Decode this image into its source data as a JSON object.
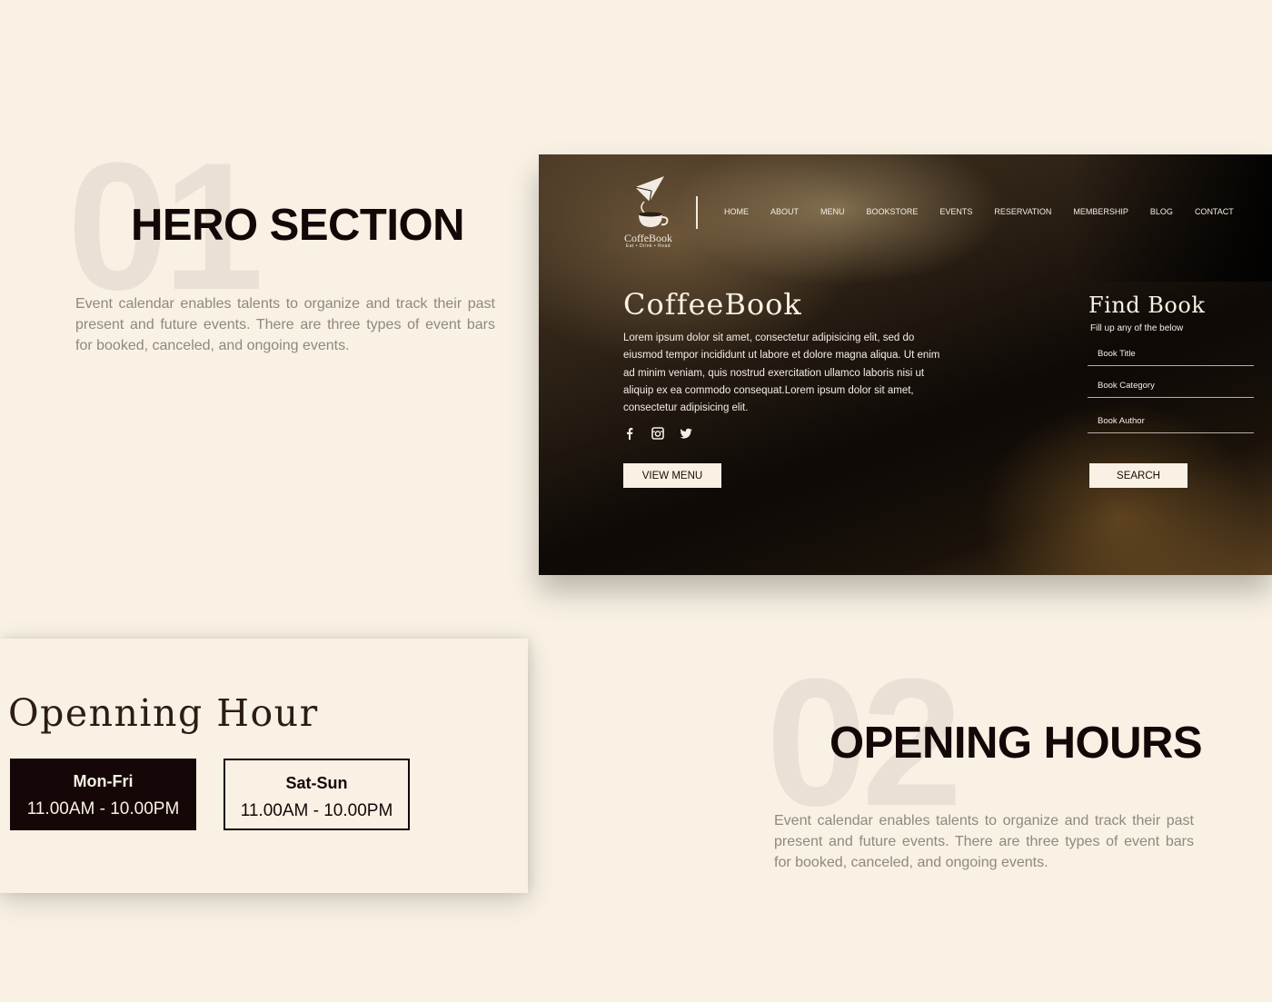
{
  "section1": {
    "number": "01",
    "title": "HERO SECTION",
    "description": "Event calendar enables talents to organize and track their past present and future events. There are three types of event bars for booked, canceled, and ongoing events."
  },
  "hero": {
    "logo": {
      "brand": "CoffeBook",
      "tagline": "Eat • Drink • Read"
    },
    "nav": [
      "HOME",
      "ABOUT",
      "MENU",
      "BOOKSTORE",
      "EVENTS",
      "RESERVATION",
      "MEMBERSHIP",
      "BLOG",
      "CONTACT"
    ],
    "title": "CoffeeBook",
    "body": "Lorem ipsum dolor sit amet, consectetur adipisicing elit, sed do eiusmod tempor incididunt ut labore et dolore magna aliqua. Ut enim ad minim veniam, quis nostrud exercitation ullamco laboris nisi ut aliquip ex ea commodo consequat.Lorem ipsum dolor sit  amet, consectetur adipisicing elit.",
    "social_icons": [
      "facebook-icon",
      "instagram-icon",
      "twitter-icon"
    ],
    "view_menu_label": "VIEW MENU",
    "find": {
      "title": "Find Book",
      "subtitle": "Fill up any of the below",
      "fields": [
        "Book Title",
        "Book Category",
        "Book Author"
      ],
      "search_label": "SEARCH"
    }
  },
  "hours_card": {
    "title": "Openning Hour",
    "weekday": {
      "day": "Mon-Fri",
      "time": "11.00AM - 10.00PM"
    },
    "weekend": {
      "day": "Sat-Sun",
      "time": "11.00AM - 10.00PM"
    }
  },
  "section2": {
    "number": "02",
    "title": "OPENING HOURS",
    "description": "Event calendar enables talents to organize and track their past present and future events. There are three types of event bars for booked, canceled, and ongoing events."
  },
  "colors": {
    "background": "#f8f1e4",
    "heading": "#140707",
    "muted_text": "#8f8880",
    "big_number": "#e9e1d5",
    "dark_box": "#150707"
  }
}
